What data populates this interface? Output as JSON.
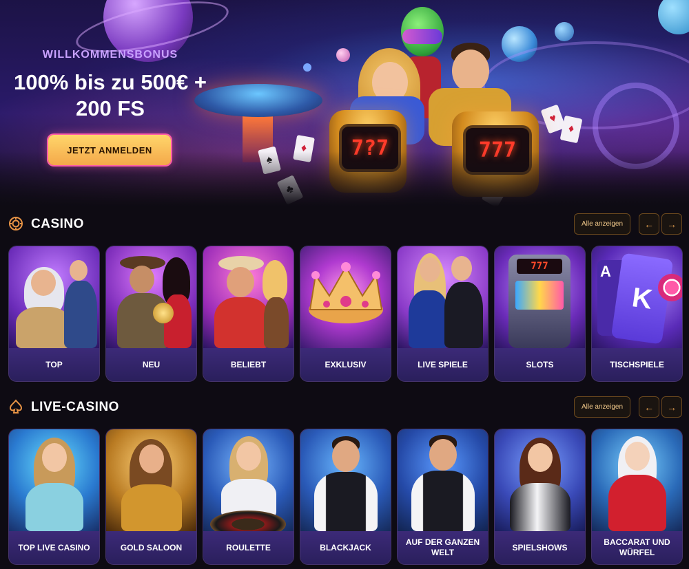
{
  "hero": {
    "subtitle": "WILLKOMMENSBONUS",
    "title_line1": "100% bis zu 500€ +",
    "title_line2": "200 FS",
    "cta_label": "JETZT ANMELDEN",
    "kart_left_screen": "7?7",
    "kart_right_screen": "777"
  },
  "casino": {
    "title": "CASINO",
    "view_all": "Alle anzeigen",
    "tiles": [
      {
        "label": "TOP"
      },
      {
        "label": "NEU"
      },
      {
        "label": "BELIEBT"
      },
      {
        "label": "EXKLUSIV"
      },
      {
        "label": "LIVE SPIELE"
      },
      {
        "label": "SLOTS"
      },
      {
        "label": "TISCHSPIELE"
      }
    ],
    "slot_display": "777"
  },
  "live_casino": {
    "title": "LIVE-CASINO",
    "view_all": "Alle anzeigen",
    "tiles": [
      {
        "label": "TOP LIVE CASINO"
      },
      {
        "label": "GOLD SALOON"
      },
      {
        "label": "ROULETTE"
      },
      {
        "label": "BLACKJACK"
      },
      {
        "label": "AUF DER GANZEN WELT"
      },
      {
        "label": "SPIELSHOWS"
      },
      {
        "label": "BACCARAT UND WÜRFEL"
      }
    ]
  },
  "icons": {
    "casino_section": "chip-icon",
    "live_section": "spade-icon",
    "prev": "arrow-left-icon",
    "next": "arrow-right-icon"
  },
  "colors": {
    "background": "#0e0b13",
    "accent": "#e79345",
    "cta": "#ffd66b",
    "tile_label": "#3c2a78"
  }
}
